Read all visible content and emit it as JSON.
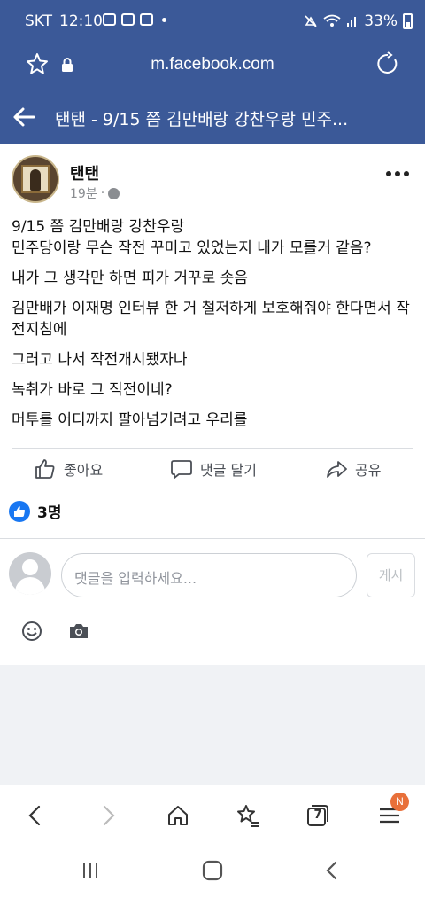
{
  "status": {
    "carrier": "SKT",
    "time": "12:10",
    "battery": "33%"
  },
  "browser": {
    "url": "m.facebook.com",
    "tab_count": "7",
    "menu_badge": "N"
  },
  "header": {
    "title": "탠탠 - 9/15 쯤 김만배랑 강찬우랑 민주..."
  },
  "post": {
    "author": "탠탠",
    "time": "19분",
    "lines": [
      "9/15 쯤 김만배랑 강찬우랑\n민주당이랑 무슨 작전 꾸미고 있었는지 내가 모를거 같음?",
      "내가 그 생각만 하면 피가 거꾸로 솟음",
      "김만배가 이재명 인터뷰 한 거 철저하게 보호해줘야 한다면서 작전지침에",
      "그러고 나서 작전개시됐자나",
      "녹취가 바로 그 직전이네?",
      "머투를 어디까지 팔아넘기려고 우리를"
    ]
  },
  "actions": {
    "like": "좋아요",
    "comment": "댓글 달기",
    "share": "공유"
  },
  "reactions": {
    "count": "3명"
  },
  "comment_box": {
    "placeholder": "댓글을 입력하세요...",
    "post": "게시"
  },
  "colors": {
    "facebook_blue": "#3b5998",
    "like_blue": "#1877f2",
    "badge": "#e8703a"
  }
}
